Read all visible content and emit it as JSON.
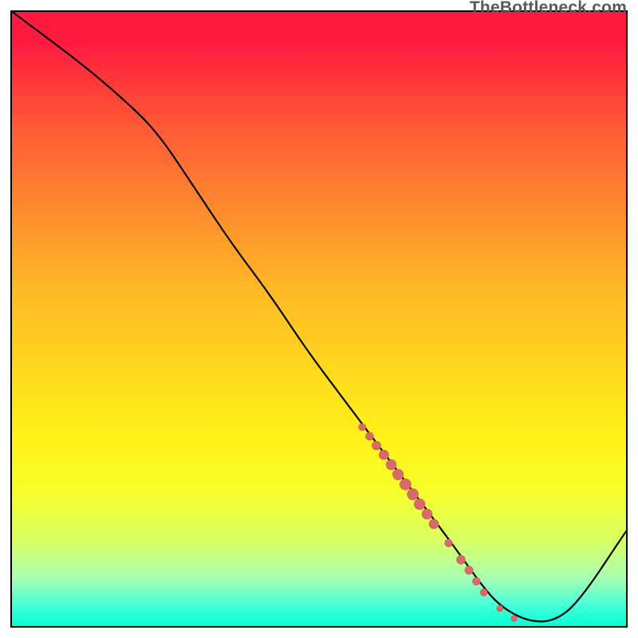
{
  "watermark": "TheBottleneck.com",
  "colors": {
    "top": "#ff1a3f",
    "bottom": "#00ffd6",
    "curve_stroke": "#000000",
    "marker_fill": "#d86a6a",
    "marker_stroke": "#c45a5a"
  },
  "chart_data": {
    "type": "line",
    "title": "",
    "xlabel": "",
    "ylabel": "",
    "xlim": [
      0,
      100
    ],
    "ylim": [
      0,
      100
    ],
    "x": [
      0,
      4,
      12,
      19,
      24,
      30,
      36,
      42,
      48,
      54,
      60,
      66,
      72,
      77,
      80,
      84,
      88,
      92,
      100
    ],
    "values": [
      100,
      97,
      91,
      85,
      80,
      71,
      62,
      54,
      45,
      37,
      29,
      21,
      13,
      6,
      3,
      1,
      1,
      4,
      16
    ],
    "markers": [
      {
        "x": 57.0,
        "y": 32.5,
        "size": 4.5
      },
      {
        "x": 58.2,
        "y": 31.0,
        "size": 5.0
      },
      {
        "x": 59.3,
        "y": 29.5,
        "size": 5.5
      },
      {
        "x": 60.5,
        "y": 28.0,
        "size": 6.0
      },
      {
        "x": 61.7,
        "y": 26.4,
        "size": 6.4
      },
      {
        "x": 62.8,
        "y": 24.8,
        "size": 6.7
      },
      {
        "x": 64.0,
        "y": 23.2,
        "size": 7.0
      },
      {
        "x": 65.2,
        "y": 21.6,
        "size": 7.0
      },
      {
        "x": 66.3,
        "y": 20.0,
        "size": 6.8
      },
      {
        "x": 67.5,
        "y": 18.4,
        "size": 6.4
      },
      {
        "x": 68.6,
        "y": 16.8,
        "size": 6.0
      },
      {
        "x": 71.0,
        "y": 13.7,
        "size": 4.8
      },
      {
        "x": 73.0,
        "y": 11.0,
        "size": 5.5
      },
      {
        "x": 74.3,
        "y": 9.3,
        "size": 5.2
      },
      {
        "x": 75.5,
        "y": 7.5,
        "size": 4.9
      },
      {
        "x": 76.7,
        "y": 5.7,
        "size": 4.5
      },
      {
        "x": 79.3,
        "y": 3.1,
        "size": 4.0
      },
      {
        "x": 81.6,
        "y": 1.5,
        "size": 3.8
      }
    ]
  }
}
